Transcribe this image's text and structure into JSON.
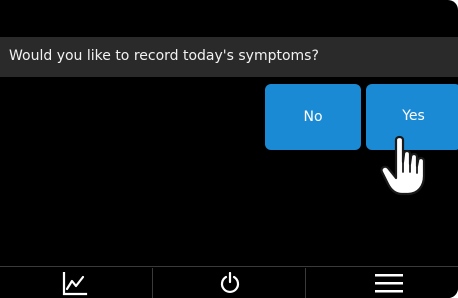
{
  "dialog": {
    "prompt": "Would you like to record today's symptoms?",
    "no_label": "No",
    "yes_label": "Yes"
  },
  "nav": {
    "items": [
      {
        "icon": "chart-icon"
      },
      {
        "icon": "power-icon"
      },
      {
        "icon": "menu-icon"
      }
    ]
  },
  "colors": {
    "background": "#000000",
    "prompt_bar": "#2a2a2a",
    "button": "#1b8ad4",
    "text": "#f2f2f2"
  }
}
